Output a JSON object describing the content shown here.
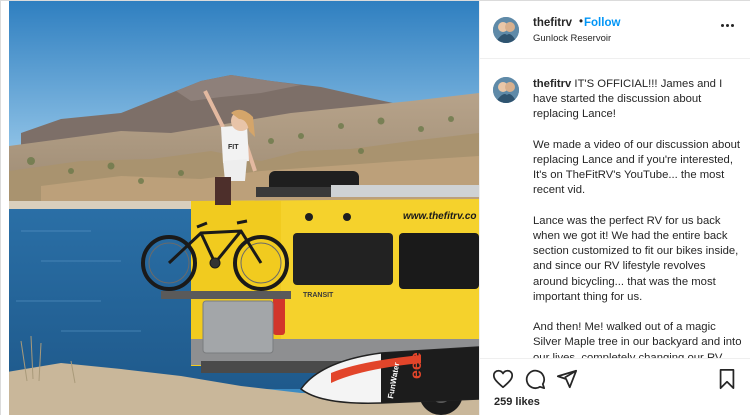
{
  "post": {
    "username": "thefitrv",
    "separator": "•",
    "follow_label": "Follow",
    "location": "Gunlock Reservoir",
    "more_icon": "more-horizontal-icon"
  },
  "photo": {
    "van_text": "www.thefitrv.co",
    "van_brand": "TRANSIT",
    "board_text_1": "eee",
    "board_text_2": "FunWater",
    "colors": {
      "sky": "#3c8bc2",
      "lake": "#2f72a6",
      "van": "#f5d22c",
      "board_stripe": "#e2452a"
    }
  },
  "caption": {
    "username": "thefitrv",
    "lead": " IT'S OFFICIAL!!! James and I have started the discussion about replacing Lance!",
    "paragraphs": [
      "We made a video of our discussion about replacing Lance and if you're interested, It's on TheFitRV's YouTube... the most recent vid.",
      "Lance was the perfect RV for us back when we got it! We had the entire back section customized to fit our bikes inside, and since our RV lifestyle revolves around bicycling... that was the most important thing for us.",
      "And then! Me! walked out of a magic Silver Maple tree in our backyard and into our lives, completely changing our RV needs. Lance works great for"
    ]
  },
  "actions": {
    "like_icon": "heart-icon",
    "comment_icon": "comment-icon",
    "share_icon": "share-icon",
    "save_icon": "bookmark-icon",
    "likes": "259 likes"
  }
}
